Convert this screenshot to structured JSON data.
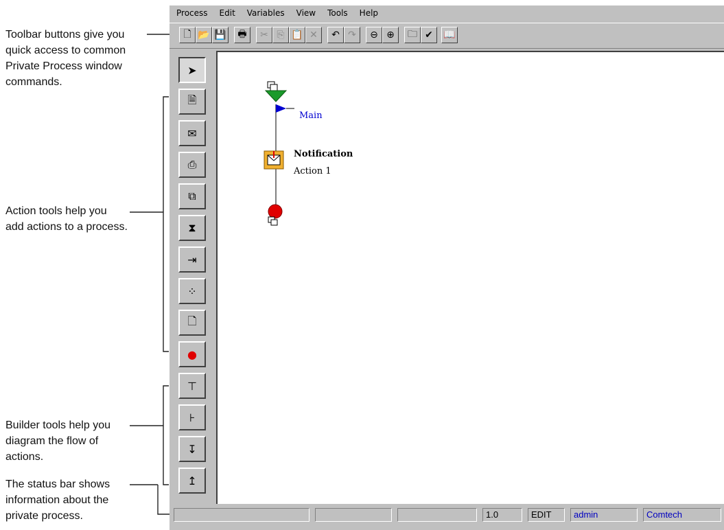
{
  "callouts": {
    "toolbar": [
      "Toolbar buttons give you",
      "quick access to common",
      "Private Process window",
      "commands."
    ],
    "action_tools": [
      "Action tools help you",
      "add actions to a process."
    ],
    "builder_tools": [
      "Builder tools help you",
      "diagram the flow of",
      "actions."
    ],
    "status_bar": [
      "The status bar shows",
      "information about the",
      "private process."
    ]
  },
  "menubar": {
    "items": [
      "Process",
      "Edit",
      "Variables",
      "View",
      "Tools",
      "Help"
    ]
  },
  "toolbar": {
    "buttons": [
      {
        "icon": "new-document-icon",
        "glyph": "🗋"
      },
      {
        "icon": "open-folder-icon",
        "glyph": "📂"
      },
      {
        "icon": "save-disk-icon",
        "glyph": "💾"
      },
      {
        "icon": "print-icon",
        "glyph": "🖶"
      },
      {
        "icon": "cut-icon",
        "glyph": "✂"
      },
      {
        "icon": "copy-icon",
        "glyph": "⎘"
      },
      {
        "icon": "paste-icon",
        "glyph": "📋"
      },
      {
        "icon": "delete-icon",
        "glyph": "✕"
      },
      {
        "icon": "undo-icon",
        "glyph": "↶"
      },
      {
        "icon": "redo-icon",
        "glyph": "↷"
      },
      {
        "icon": "zoom-out-icon",
        "glyph": "⊖"
      },
      {
        "icon": "zoom-in-icon",
        "glyph": "⊕"
      },
      {
        "icon": "properties-icon",
        "glyph": "🗀"
      },
      {
        "icon": "validate-check-icon",
        "glyph": "✔"
      },
      {
        "icon": "help-book-icon",
        "glyph": "📖"
      }
    ]
  },
  "palette": {
    "tools": [
      {
        "icon": "select-arrow-icon",
        "glyph": "➤"
      },
      {
        "icon": "script-action-icon",
        "glyph": "🗎"
      },
      {
        "icon": "notification-action-icon",
        "glyph": "✉"
      },
      {
        "icon": "stamp-action-icon",
        "glyph": "⎙"
      },
      {
        "icon": "copy-action-icon",
        "glyph": "⧉"
      },
      {
        "icon": "hourglass-icon",
        "glyph": "⧗"
      },
      {
        "icon": "transfer-action-icon",
        "glyph": "⇥"
      },
      {
        "icon": "map-action-icon",
        "glyph": "⁘"
      },
      {
        "icon": "document-action-icon",
        "glyph": "🗋"
      },
      {
        "icon": "stop-icon",
        "glyph": "●"
      },
      {
        "icon": "add-branch-icon",
        "glyph": "⊤"
      },
      {
        "icon": "add-sibling-icon",
        "glyph": "⊦"
      },
      {
        "icon": "move-down-icon",
        "glyph": "↧"
      },
      {
        "icon": "move-up-icon",
        "glyph": "↥"
      }
    ]
  },
  "diagram": {
    "branch_label": "Main",
    "action_title": "Notification",
    "action_subtitle": "Action 1"
  },
  "statusbar": {
    "fields": [
      "",
      "",
      "",
      "1.0",
      "EDIT",
      "admin",
      "Comtech"
    ]
  }
}
